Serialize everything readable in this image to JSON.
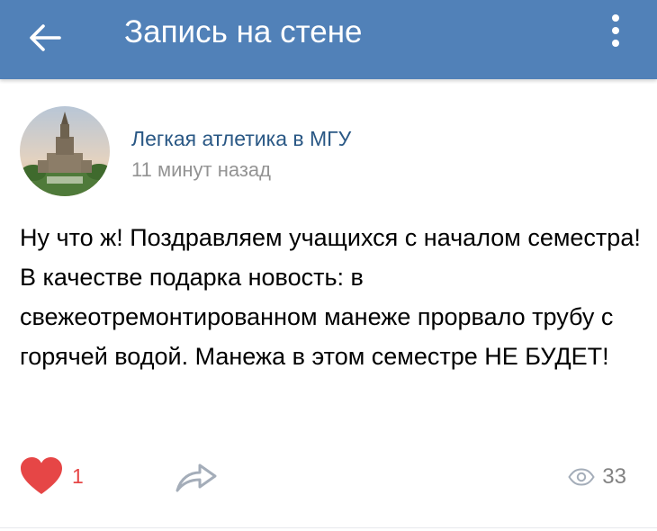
{
  "appbar": {
    "title": "Запись на стене",
    "back_icon": "arrow-left-icon",
    "more_icon": "more-vertical-icon",
    "background": "#5181b8"
  },
  "post": {
    "author": "Легкая атлетика в МГУ",
    "time": "11 минут назад",
    "text": "Ну что ж! Поздравляем учащихся с началом семестра! В качестве подарка новость: в свежеотремонтированном манеже прорвало трубу с горячей водой. Манежа в этом семестре НЕ БУДЕТ!",
    "avatar_icon": "building-photo-avatar"
  },
  "actions": {
    "likes": "1",
    "like_icon": "heart-icon",
    "share_icon": "share-icon",
    "views": "33",
    "views_icon": "eye-icon",
    "like_color": "#e64646",
    "link_color": "#2a5885"
  }
}
